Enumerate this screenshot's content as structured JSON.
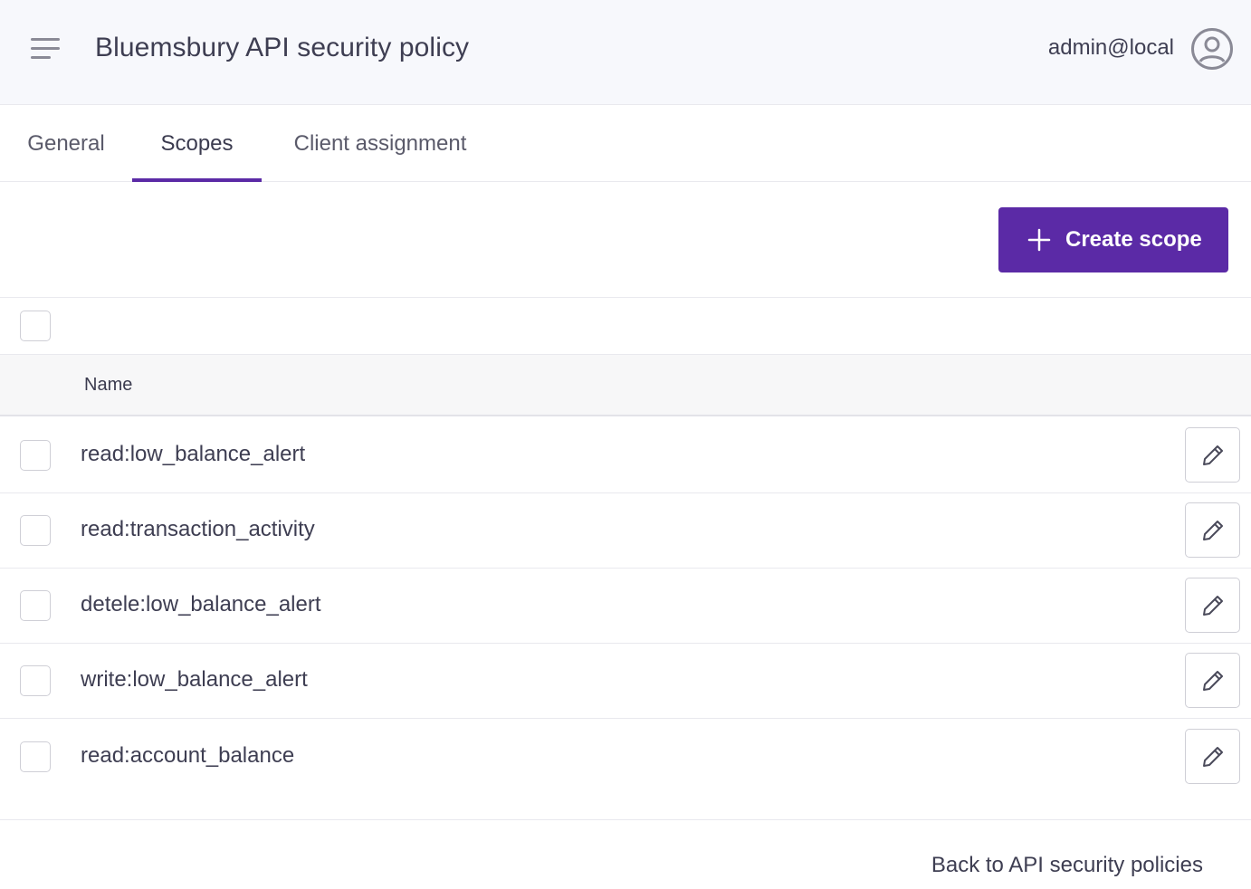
{
  "header": {
    "title": "Bluemsbury API security policy",
    "user_email": "admin@local",
    "menu_icon": "hamburger-menu-icon",
    "avatar_icon": "user-circle-icon"
  },
  "tabs": [
    {
      "label": "General",
      "active": false
    },
    {
      "label": "Scopes",
      "active": true
    },
    {
      "label": "Client assignment",
      "active": false
    }
  ],
  "toolbar": {
    "create_label": "Create scope",
    "create_icon": "plus-icon"
  },
  "table": {
    "columns": [
      "Name"
    ],
    "rows": [
      {
        "name": "read:low_balance_alert",
        "checked": false
      },
      {
        "name": "read:transaction_activity",
        "checked": false
      },
      {
        "name": "detele:low_balance_alert",
        "checked": false
      },
      {
        "name": "write:low_balance_alert",
        "checked": false
      },
      {
        "name": "read:account_balance",
        "checked": false
      }
    ],
    "edit_icon": "pencil-icon"
  },
  "footer": {
    "back_label": "Back to API security policies"
  },
  "colors": {
    "accent": "#5b2aa6",
    "header_bg": "#f7f8fc",
    "text": "#3e3e52"
  }
}
